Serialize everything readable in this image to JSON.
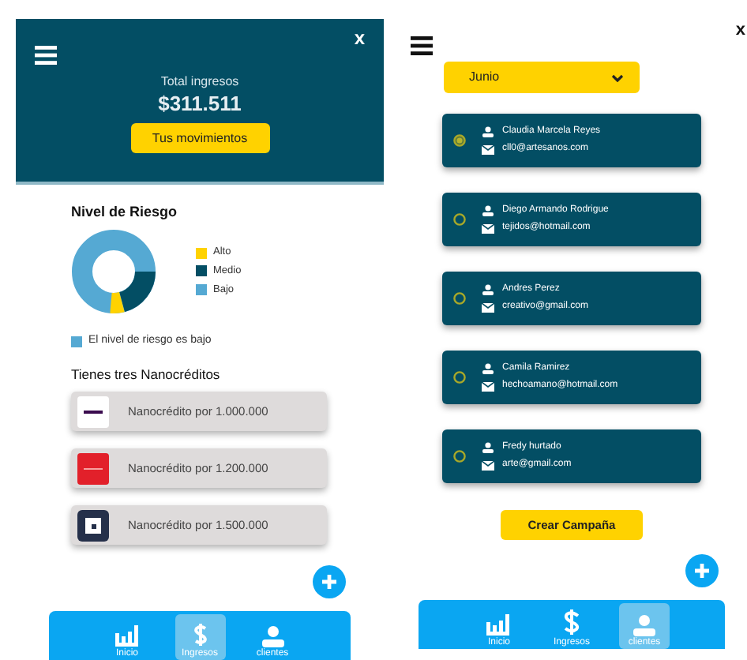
{
  "left_screen": {
    "close": "x",
    "header": {
      "caption": "Total ingresos",
      "amount": "$311.511",
      "button": "Tus movimientos"
    },
    "risk": {
      "title": "Nivel de Riesgo",
      "legend": [
        {
          "label": "Alto",
          "color": "#ffd200"
        },
        {
          "label": "Medio",
          "color": "#034e64"
        },
        {
          "label": "Bajo",
          "color": "#55a9d3"
        }
      ],
      "note": "El nivel de riesgo es bajo"
    },
    "credits_title": "Tienes tres Nanocréditos",
    "credits": [
      {
        "kind": "white",
        "label": "Nanocrédito por 1.000.000"
      },
      {
        "kind": "red",
        "label": "Nanocrédito por 1.200.000"
      },
      {
        "kind": "dark",
        "label": "Nanocrédito por 1.500.000"
      }
    ],
    "nav": [
      {
        "kind": "home",
        "label": "Inicio",
        "selected": false
      },
      {
        "kind": "money",
        "label": "Ingresos",
        "selected": true
      },
      {
        "kind": "user",
        "label": "clientes",
        "selected": false
      }
    ]
  },
  "right_screen": {
    "close": "x",
    "month": "Junio",
    "clients": [
      {
        "name": "Claudia Marcela Reyes",
        "email": "cll0@artesanos.com",
        "selected": true
      },
      {
        "name": "Diego Armando Rodrigue",
        "email": "tejidos@hotmail.com",
        "selected": false
      },
      {
        "name": "Andres Perez",
        "email": "creativo@gmail.com",
        "selected": false
      },
      {
        "name": "Camila Ramirez",
        "email": "hechoamano@hotmail.com",
        "selected": false
      },
      {
        "name": "Fredy hurtado",
        "email": "arte@gmail.com",
        "selected": false
      }
    ],
    "button": "Crear Campaña",
    "nav": [
      {
        "kind": "home",
        "label": "Inicio",
        "selected": false
      },
      {
        "kind": "dollar",
        "label": "Ingresos",
        "selected": false
      },
      {
        "kind": "user",
        "label": "clientes",
        "selected": true
      }
    ]
  }
}
